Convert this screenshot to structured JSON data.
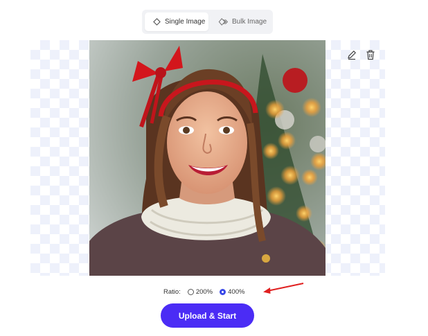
{
  "mode_toggle": {
    "single_label": "Single Image",
    "bulk_label": "Bulk Image",
    "active": "single"
  },
  "editor": {
    "photo_icon": "portrait-photo",
    "edit_icon": "pencil-icon",
    "delete_icon": "trash-icon"
  },
  "ratio": {
    "label": "Ratio:",
    "options": [
      {
        "label": "200%",
        "selected": false
      },
      {
        "label": "400%",
        "selected": true
      }
    ]
  },
  "upload_button": "Upload & Start",
  "colors": {
    "accent": "#4b2cf5",
    "radio_selected": "#3a49e8",
    "annotation_arrow": "#e02020"
  }
}
